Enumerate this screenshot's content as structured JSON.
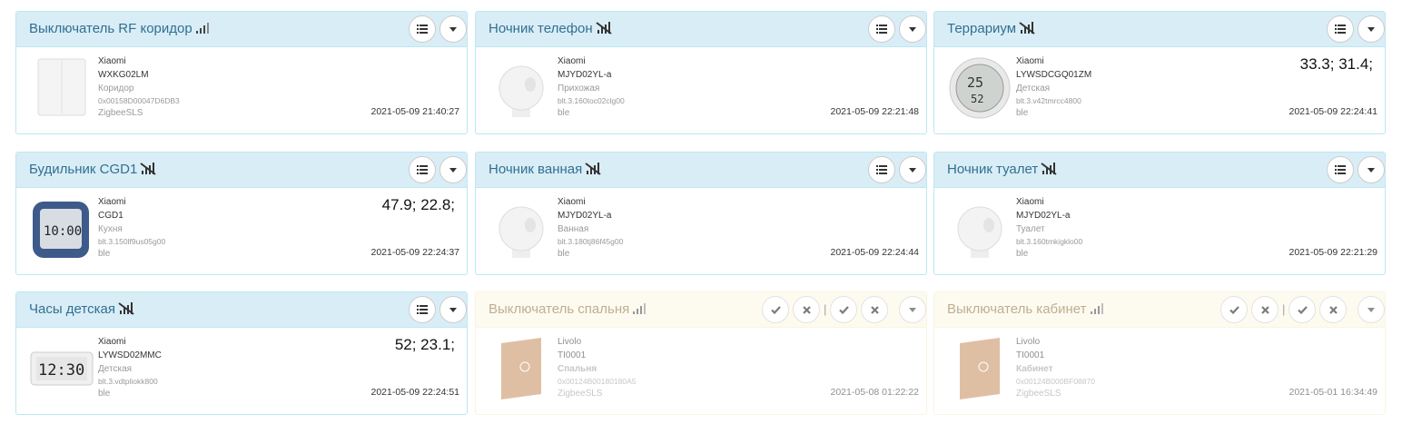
{
  "cards": [
    {
      "title": "Выключатель RF коридор",
      "signal": "good",
      "vendor": "Xiaomi",
      "model": "WXKG02LM",
      "room": "Коридор",
      "id": "0x00158D00047D6DB3",
      "source": "ZigbeeSLS",
      "value": "",
      "timestamp": "2021-05-09 21:40:27",
      "icon": "switch-white-icon"
    },
    {
      "title": "Ночник телефон",
      "signal": "none",
      "vendor": "Xiaomi",
      "model": "MJYD02YL-a",
      "room": "Прихожая",
      "id": "blt.3.160toc02clg00",
      "source": "ble",
      "value": "",
      "timestamp": "2021-05-09 22:21:48",
      "icon": "nightlight-icon"
    },
    {
      "title": "Террариум",
      "signal": "none",
      "vendor": "Xiaomi",
      "model": "LYWSDCGQ01ZM",
      "room": "Детская",
      "id": "blt.3.v42tmrcc4800",
      "source": "ble",
      "value": "33.3; 31.4;",
      "timestamp": "2021-05-09 22:24:41",
      "icon": "round-thermometer-icon"
    },
    {
      "title": "Будильник CGD1",
      "signal": "none",
      "vendor": "Xiaomi",
      "model": "CGD1",
      "room": "Кухня",
      "id": "blt.3.150lf9us05g00",
      "source": "ble",
      "value": "47.9; 22.8;",
      "timestamp": "2021-05-09 22:24:37",
      "icon": "alarm-clock-icon"
    },
    {
      "title": "Ночник ванная",
      "signal": "none",
      "vendor": "Xiaomi",
      "model": "MJYD02YL-a",
      "room": "Ванная",
      "id": "blt.3.180tj86f45g00",
      "source": "ble",
      "value": "",
      "timestamp": "2021-05-09 22:24:44",
      "icon": "nightlight-icon"
    },
    {
      "title": "Ночник туалет",
      "signal": "none",
      "vendor": "Xiaomi",
      "model": "MJYD02YL-a",
      "room": "Туалет",
      "id": "blt.3.160tmkigklo00",
      "source": "ble",
      "value": "",
      "timestamp": "2021-05-09 22:21:29",
      "icon": "nightlight-icon"
    },
    {
      "title": "Часы детская",
      "signal": "none",
      "vendor": "Xiaomi",
      "model": "LYWSD02MMC",
      "room": "Детская",
      "id": "blt.3.vdtpliokk800",
      "source": "ble",
      "value": "52; 23.1;",
      "timestamp": "2021-05-09 22:24:51",
      "icon": "e-ink-clock-icon"
    },
    {
      "title": "Выключатель спальня",
      "signal": "good",
      "vendor": "Livolo",
      "model": "TI0001",
      "room": "Спальня",
      "id": "0x00124B00180180A5",
      "source": "ZigbeeSLS",
      "value": "",
      "timestamp": "2021-05-08 01:22:22",
      "icon": "gold-switch-icon"
    },
    {
      "title": "Выключатель кабинет",
      "signal": "good",
      "vendor": "Livolo",
      "model": "TI0001",
      "room": "Кабинет",
      "id": "0x00124B000BF08870",
      "source": "ZigbeeSLS",
      "value": "",
      "timestamp": "2021-05-01 16:34:49",
      "icon": "gold-switch-icon"
    }
  ],
  "colors": {
    "info_header": "#d9edf7",
    "warning_header": "#fcf8e3",
    "title_blue": "#31708f"
  }
}
